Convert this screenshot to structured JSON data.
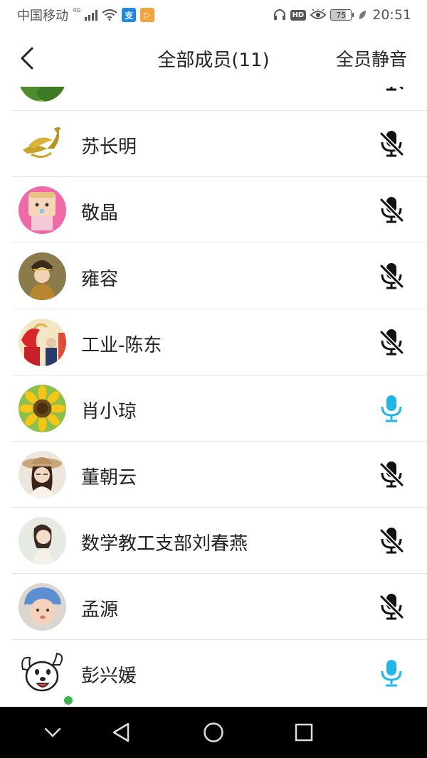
{
  "status_bar": {
    "carrier": "中国移动",
    "network": "4G",
    "alipay_badge": "支",
    "app_badge": "▷",
    "hd": "HD",
    "battery": "75",
    "battery_level": 0.75,
    "time": "20:51"
  },
  "header": {
    "title": "全部成员(11)",
    "mute_all": "全员静音"
  },
  "members": [
    {
      "name": "",
      "mic": "muted",
      "avatar": "landscape"
    },
    {
      "name": "苏长明",
      "mic": "muted",
      "avatar": "phoenix-logo"
    },
    {
      "name": "敬晶",
      "mic": "muted",
      "avatar": "pink-cartoon"
    },
    {
      "name": "雍容",
      "mic": "muted",
      "avatar": "portrait-headdress"
    },
    {
      "name": "工业-陈东",
      "mic": "muted",
      "avatar": "red-dragon"
    },
    {
      "name": "肖小琼",
      "mic": "active",
      "avatar": "sunflower"
    },
    {
      "name": "董朝云",
      "mic": "muted",
      "avatar": "portrait-hat"
    },
    {
      "name": "数学教工支部刘春燕",
      "mic": "muted",
      "avatar": "portrait-light"
    },
    {
      "name": "孟源",
      "mic": "muted",
      "avatar": "baby-blue-hat"
    },
    {
      "name": "彭兴媛",
      "mic": "active",
      "avatar": "cartoon-dog",
      "online": true
    }
  ],
  "colors": {
    "mic_active": "#1fb6ea",
    "mic_muted": "#111111",
    "divider": "#e6e6e6"
  },
  "nav_icons": [
    "chevron-down-icon",
    "back-triangle-icon",
    "home-circle-icon",
    "recents-square-icon"
  ]
}
